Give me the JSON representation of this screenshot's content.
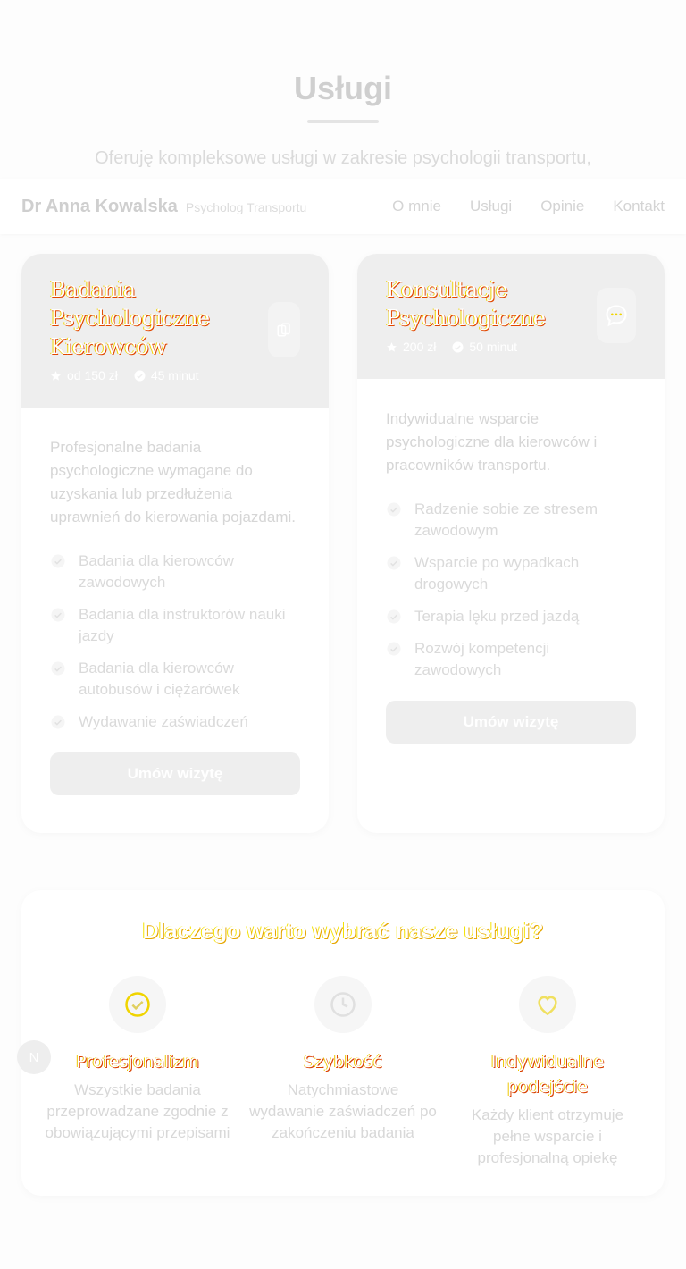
{
  "section": {
    "title": "Usługi",
    "subtitle": "Oferuję kompleksowe usługi w zakresie psychologii transportu,"
  },
  "nav": {
    "brand": "Dr Anna Kowalska",
    "brand_sub": "Psycholog Transportu",
    "links": [
      "O mnie",
      "Usługi",
      "Opinie",
      "Kontakt"
    ]
  },
  "services": [
    {
      "title": "Badania Psychologiczne Kierowców",
      "price": "od 150 zł",
      "duration": "45 minut",
      "icon": "document-copy-icon",
      "description": "Profesjonalne badania psychologiczne wymagane do uzyskania lub przedłużenia uprawnień do kierowania pojazdami.",
      "features": [
        "Badania dla kierowców zawodowych",
        "Badania dla instruktorów nauki jazdy",
        "Badania dla kierowców autobusów i ciężarówek",
        "Wydawanie zaświadczeń"
      ],
      "button": "Umów wizytę"
    },
    {
      "title": "Konsultacje Psychologiczne",
      "price": "200 zł",
      "duration": "50 minut",
      "icon": "chat-bubble-icon",
      "description": "Indywidualne wsparcie psychologiczne dla kierowców i pracowników transportu.",
      "features": [
        "Radzenie sobie ze stresem zawodowym",
        "Wsparcie po wypadkach drogowych",
        "Terapia lęku przed jazdą",
        "Rozwój kompetencji zawodowych"
      ],
      "button": "Umów wizytę"
    }
  ],
  "why": {
    "title": "Dlaczego warto wybrać nasze usługi?",
    "items": [
      {
        "icon": "check-circle-icon",
        "title": "Profesjonalizm",
        "text": "Wszystkie badania przeprowadzane zgodnie z obowiązującymi przepisami"
      },
      {
        "icon": "clock-icon",
        "title": "Szybkość",
        "text": "Natychmiastowe wydawanie zaświadczeń po zakończeniu badania"
      },
      {
        "icon": "heart-icon",
        "title": "Indywidualne podejście",
        "text": "Każdy klient otrzymuje pełne wsparcie i profesjonalną opiekę"
      }
    ]
  },
  "avatar": {
    "initial": "N"
  },
  "colors": {
    "accent_yellow": "#f0d400",
    "accent_red": "#e14700",
    "card_header": "#eeeeee"
  }
}
